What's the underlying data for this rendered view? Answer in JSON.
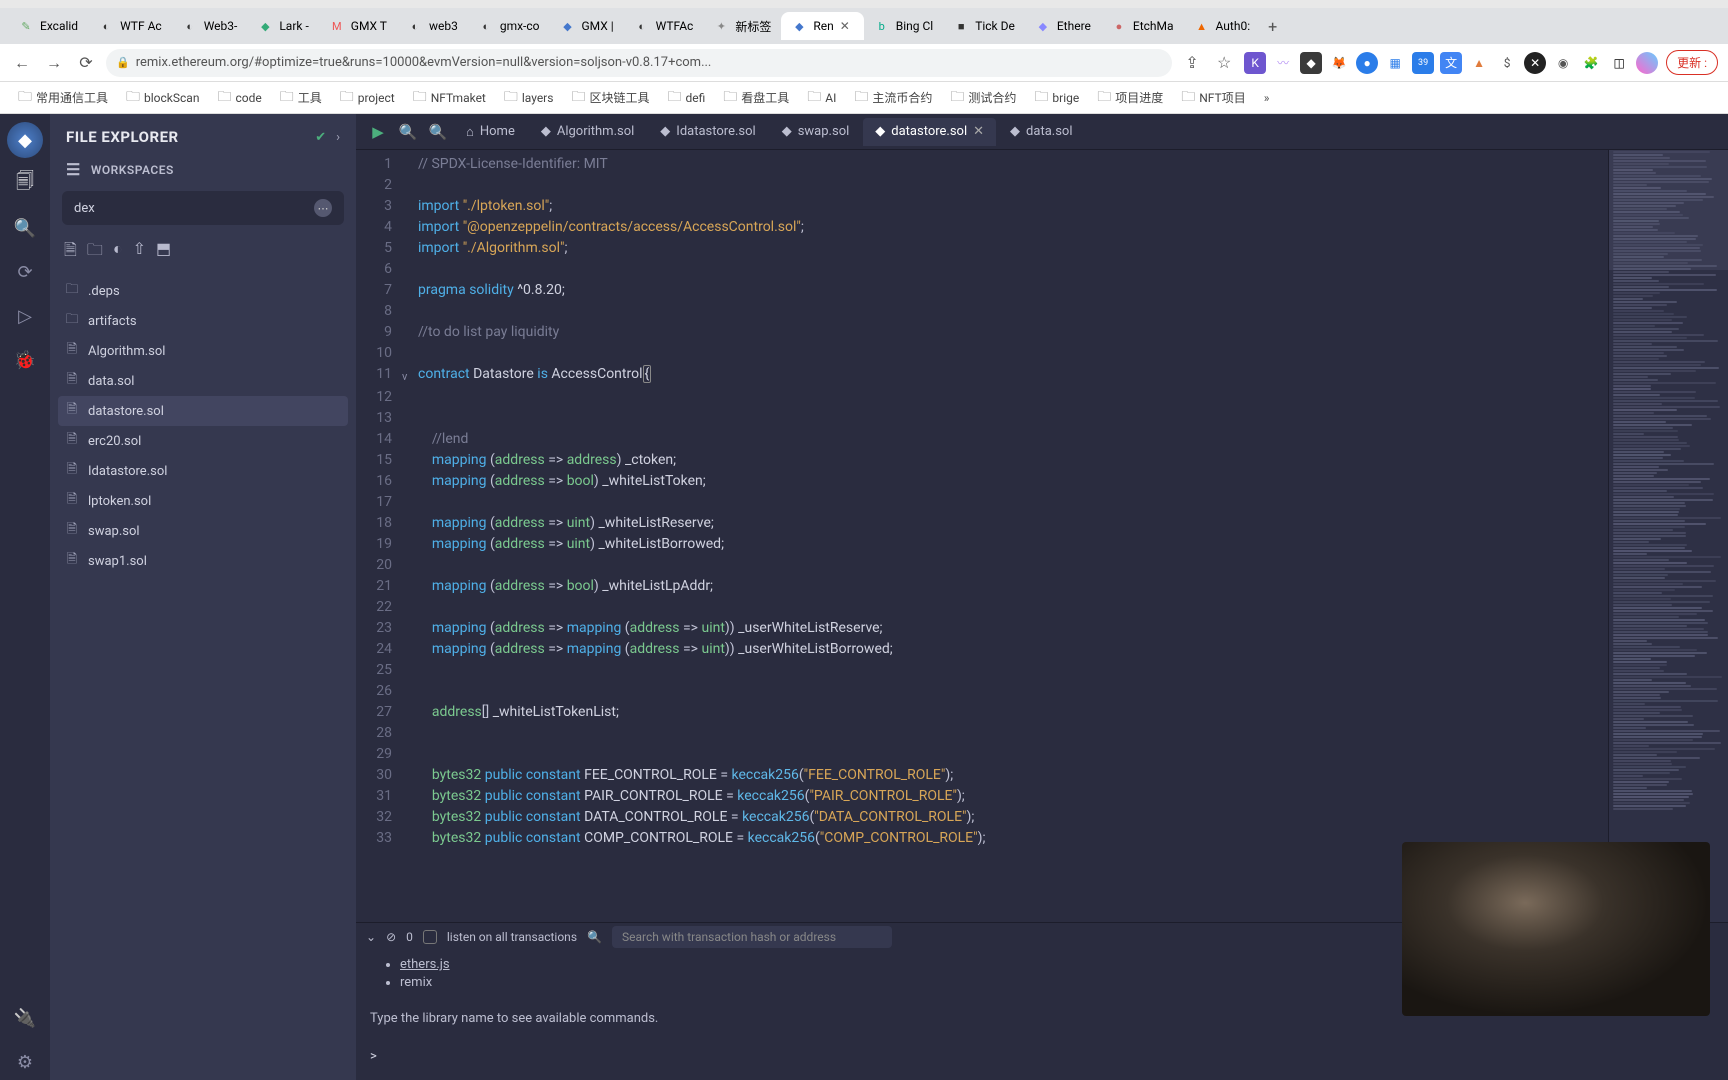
{
  "browser": {
    "tabs": [
      {
        "label": "Excalid",
        "favicon": "✎",
        "color": "#6a6"
      },
      {
        "label": "WTF Ac",
        "favicon": "◐",
        "color": "#333"
      },
      {
        "label": "Web3-",
        "favicon": "◐",
        "color": "#333"
      },
      {
        "label": "Lark - ",
        "favicon": "◆",
        "color": "#3a7"
      },
      {
        "label": "GMX T",
        "favicon": "M",
        "color": "#e55"
      },
      {
        "label": "web3 ",
        "favicon": "◐",
        "color": "#333"
      },
      {
        "label": "gmx-co",
        "favicon": "◐",
        "color": "#333"
      },
      {
        "label": "GMX | ",
        "favicon": "◆",
        "color": "#47c"
      },
      {
        "label": "WTFAc",
        "favicon": "◐",
        "color": "#333"
      },
      {
        "label": "新标签",
        "favicon": "✦",
        "color": "#888"
      },
      {
        "label": "Ren",
        "favicon": "◆",
        "color": "#47c",
        "active": true
      },
      {
        "label": "Bing Cl",
        "favicon": "b",
        "color": "#0a8"
      },
      {
        "label": "Tick De",
        "favicon": "■",
        "color": "#333"
      },
      {
        "label": "Ethere",
        "favicon": "◆",
        "color": "#88f"
      },
      {
        "label": "EtchMa",
        "favicon": "●",
        "color": "#c66"
      },
      {
        "label": "Auth0:",
        "favicon": "▲",
        "color": "#e60"
      }
    ],
    "url": "remix.ethereum.org/#optimize=true&runs=10000&evmVersion=null&version=soljson-v0.8.17+com...",
    "update_label": "更新 :",
    "bookmarks": [
      "常用通信工具",
      "blockScan",
      "code",
      "工具",
      "project",
      "NFTmaket",
      "layers",
      "区块链工具",
      "defi",
      "看盘工具",
      "AI",
      "主流币合约",
      "测试合约",
      "brige",
      "项目进度",
      "NFT项目"
    ]
  },
  "sidebar": {
    "title": "FILE EXPLORER",
    "workspaces_label": "WORKSPACES",
    "workspace_name": "dex",
    "tree": [
      {
        "label": ".deps",
        "type": "folder"
      },
      {
        "label": "artifacts",
        "type": "folder"
      },
      {
        "label": "Algorithm.sol",
        "type": "file"
      },
      {
        "label": "data.sol",
        "type": "file"
      },
      {
        "label": "datastore.sol",
        "type": "file",
        "selected": true
      },
      {
        "label": "erc20.sol",
        "type": "file"
      },
      {
        "label": "Idatastore.sol",
        "type": "file"
      },
      {
        "label": "lptoken.sol",
        "type": "file"
      },
      {
        "label": "swap.sol",
        "type": "file"
      },
      {
        "label": "swap1.sol",
        "type": "file"
      }
    ]
  },
  "editor": {
    "tabs": [
      {
        "label": "Home",
        "icon": "⌂"
      },
      {
        "label": "Algorithm.sol",
        "icon": "◆"
      },
      {
        "label": "Idatastore.sol",
        "icon": "◆"
      },
      {
        "label": "swap.sol",
        "icon": "◆"
      },
      {
        "label": "datastore.sol",
        "icon": "◆",
        "active": true
      },
      {
        "label": "data.sol",
        "icon": "◆"
      }
    ],
    "lines": [
      {
        "n": 1,
        "html": "<span class='c-comment'>// SPDX-License-Identifier: MIT</span>"
      },
      {
        "n": 2,
        "html": ""
      },
      {
        "n": 3,
        "html": "<span class='c-keyword'>import</span> <span class='c-string'>\"./lptoken.sol\"</span><span class='c-punct'>;</span>"
      },
      {
        "n": 4,
        "html": "<span class='c-keyword'>import</span> <span class='c-string'>\"@openzeppelin/contracts/access/AccessControl.sol\"</span><span class='c-punct'>;</span>"
      },
      {
        "n": 5,
        "html": "<span class='c-keyword'>import</span> <span class='c-string'>\"./Algorithm.sol\"</span><span class='c-punct'>;</span>"
      },
      {
        "n": 6,
        "html": ""
      },
      {
        "n": 7,
        "html": "<span class='c-keyword'>pragma</span> <span class='c-keyword'>solidity</span> <span class='c-ident'>^0.8.20;</span>"
      },
      {
        "n": 8,
        "html": ""
      },
      {
        "n": 9,
        "html": "<span class='c-comment'>//to do list pay liquidity</span>"
      },
      {
        "n": 10,
        "html": ""
      },
      {
        "n": 11,
        "fold": "v",
        "html": "<span class='c-keyword'>contract</span> <span class='c-ident'>Datastore</span> <span class='c-keyword'>is</span> <span class='c-ident'>AccessControl</span><span class='bracket-hl'>{</span>"
      },
      {
        "n": 12,
        "html": "    "
      },
      {
        "n": 13,
        "html": ""
      },
      {
        "n": 14,
        "html": "    <span class='c-comment'>//lend</span>"
      },
      {
        "n": 15,
        "html": "    <span class='c-keyword'>mapping</span> <span class='c-punct'>(</span><span class='c-type'>address</span> <span class='c-punct'>=&gt;</span> <span class='c-type'>address</span><span class='c-punct'>)</span> <span class='c-ident'>_ctoken;</span>"
      },
      {
        "n": 16,
        "html": "    <span class='c-keyword'>mapping</span> <span class='c-punct'>(</span><span class='c-type'>address</span> <span class='c-punct'>=&gt;</span> <span class='c-type'>bool</span><span class='c-punct'>)</span> <span class='c-ident'>_whiteListToken;</span>"
      },
      {
        "n": 17,
        "html": ""
      },
      {
        "n": 18,
        "html": "    <span class='c-keyword'>mapping</span> <span class='c-punct'>(</span><span class='c-type'>address</span> <span class='c-punct'>=&gt;</span> <span class='c-type'>uint</span><span class='c-punct'>)</span> <span class='c-ident'>_whiteListReserve;</span>"
      },
      {
        "n": 19,
        "html": "    <span class='c-keyword'>mapping</span> <span class='c-punct'>(</span><span class='c-type'>address</span> <span class='c-punct'>=&gt;</span> <span class='c-type'>uint</span><span class='c-punct'>)</span> <span class='c-ident'>_whiteListBorrowed;</span>"
      },
      {
        "n": 20,
        "html": ""
      },
      {
        "n": 21,
        "html": "    <span class='c-keyword'>mapping</span> <span class='c-punct'>(</span><span class='c-type'>address</span> <span class='c-punct'>=&gt;</span> <span class='c-type'>bool</span><span class='c-punct'>)</span> <span class='c-ident'>_whiteListLpAddr;</span>"
      },
      {
        "n": 22,
        "html": ""
      },
      {
        "n": 23,
        "html": "    <span class='c-keyword'>mapping</span> <span class='c-punct'>(</span><span class='c-type'>address</span> <span class='c-punct'>=&gt;</span> <span class='c-keyword'>mapping</span> <span class='c-punct'>(</span><span class='c-type'>address</span> <span class='c-punct'>=&gt;</span> <span class='c-type'>uint</span><span class='c-punct'>))</span> <span class='c-ident'>_userWhiteListReserve;</span>"
      },
      {
        "n": 24,
        "html": "    <span class='c-keyword'>mapping</span> <span class='c-punct'>(</span><span class='c-type'>address</span> <span class='c-punct'>=&gt;</span> <span class='c-keyword'>mapping</span> <span class='c-punct'>(</span><span class='c-type'>address</span> <span class='c-punct'>=&gt;</span> <span class='c-type'>uint</span><span class='c-punct'>))</span> <span class='c-ident'>_userWhiteListBorrowed;</span>"
      },
      {
        "n": 25,
        "html": ""
      },
      {
        "n": 26,
        "html": ""
      },
      {
        "n": 27,
        "html": "    <span class='c-type'>address</span><span class='c-punct'>[]</span> <span class='c-ident'>_whiteListTokenList;</span>"
      },
      {
        "n": 28,
        "html": ""
      },
      {
        "n": 29,
        "html": ""
      },
      {
        "n": 30,
        "html": "    <span class='c-type'>bytes32</span> <span class='c-keyword'>public</span> <span class='c-keyword'>constant</span> <span class='c-ident'>FEE_CONTROL_ROLE</span> <span class='c-punct'>=</span> <span class='c-func'>keccak256</span><span class='c-punct'>(</span><span class='c-string'>\"FEE_CONTROL_ROLE\"</span><span class='c-punct'>);</span>"
      },
      {
        "n": 31,
        "html": "    <span class='c-type'>bytes32</span> <span class='c-keyword'>public</span> <span class='c-keyword'>constant</span> <span class='c-ident'>PAIR_CONTROL_ROLE</span> <span class='c-punct'>=</span> <span class='c-func'>keccak256</span><span class='c-punct'>(</span><span class='c-string'>\"PAIR_CONTROL_ROLE\"</span><span class='c-punct'>);</span>"
      },
      {
        "n": 32,
        "html": "    <span class='c-type'>bytes32</span> <span class='c-keyword'>public</span> <span class='c-keyword'>constant</span> <span class='c-ident'>DATA_CONTROL_ROLE</span> <span class='c-punct'>=</span> <span class='c-func'>keccak256</span><span class='c-punct'>(</span><span class='c-string'>\"DATA_CONTROL_ROLE\"</span><span class='c-punct'>);</span>"
      },
      {
        "n": 33,
        "html": "    <span class='c-type'>bytes32</span> <span class='c-keyword'>public</span> <span class='c-keyword'>constant</span> <span class='c-ident'>COMP_CONTROL_ROLE</span> <span class='c-punct'>=</span> <span class='c-func'>keccak256</span><span class='c-punct'>(</span><span class='c-string'>\"COMP_CONTROL_ROLE\"</span><span class='c-punct'>);</span>"
      }
    ]
  },
  "terminal": {
    "listen_label": "listen on all transactions",
    "tx_count": "0",
    "search_placeholder": "Search with transaction hash or address",
    "lines": [
      "ethers.js",
      "remix"
    ],
    "hint": "Type the library name to see available commands.",
    "prompt": ">"
  }
}
